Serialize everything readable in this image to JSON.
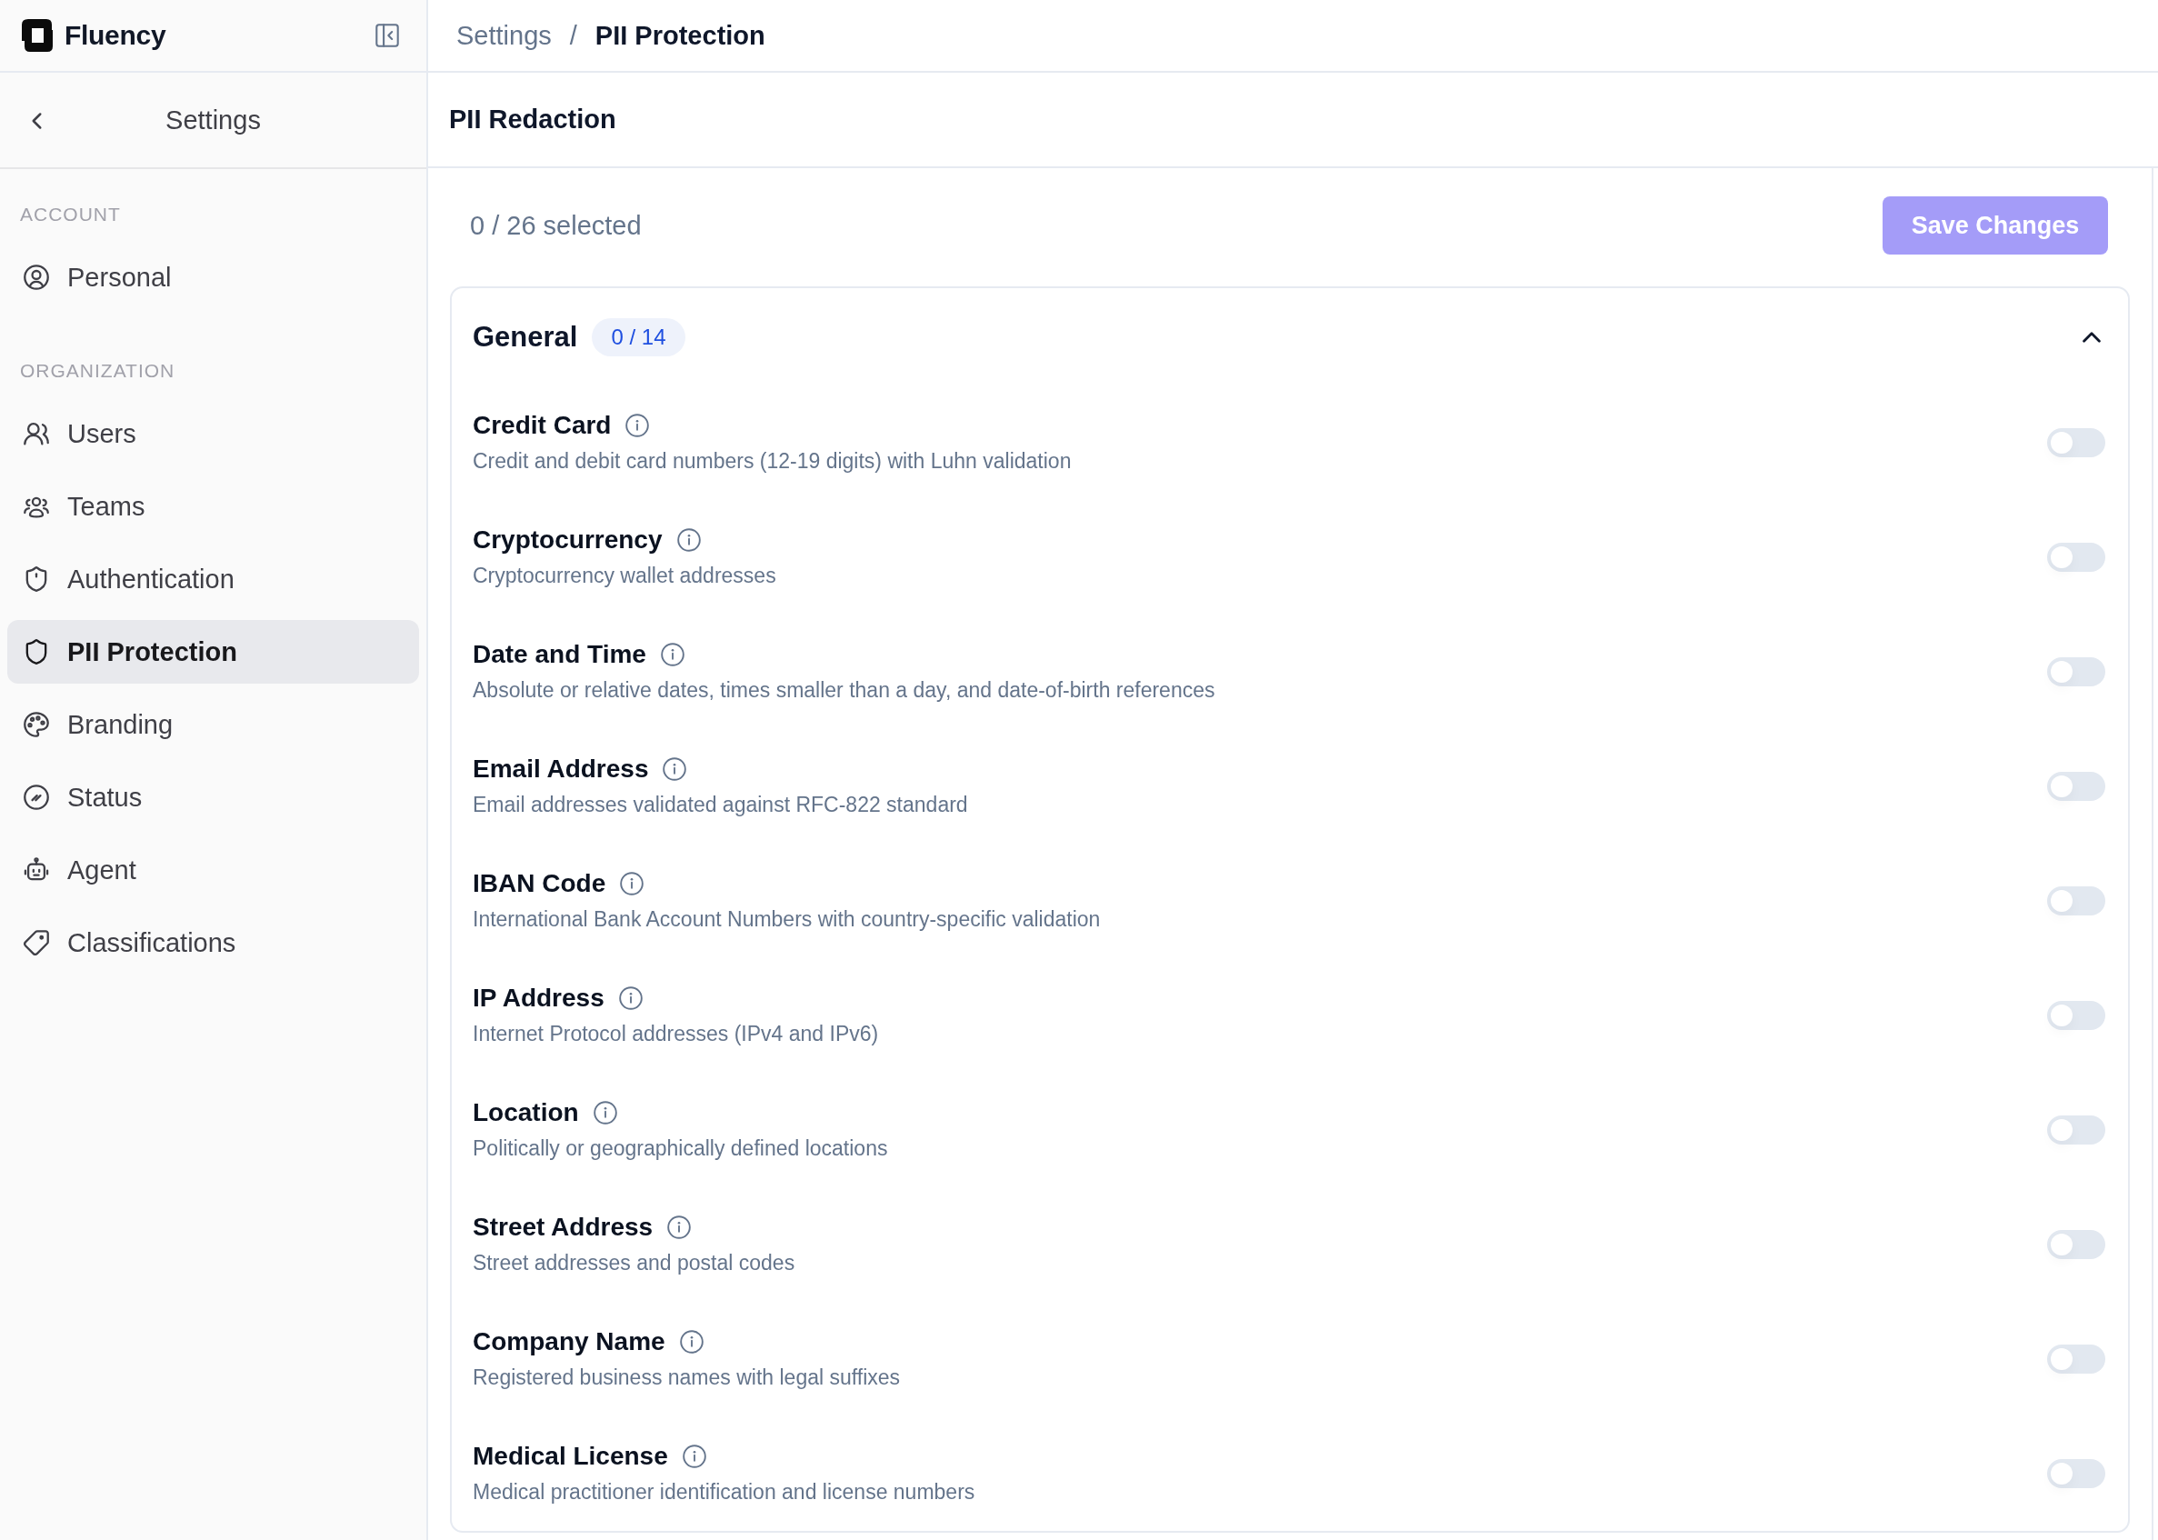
{
  "sidebar": {
    "brand": "Fluency",
    "title": "Settings",
    "sections": [
      {
        "label": "ACCOUNT",
        "items": [
          {
            "label": "Personal",
            "selected": false
          }
        ]
      },
      {
        "label": "ORGANIZATION",
        "items": [
          {
            "label": "Users",
            "selected": false
          },
          {
            "label": "Teams",
            "selected": false
          },
          {
            "label": "Authentication",
            "selected": false
          },
          {
            "label": "PII Protection",
            "selected": true
          },
          {
            "label": "Branding",
            "selected": false
          },
          {
            "label": "Status",
            "selected": false
          },
          {
            "label": "Agent",
            "selected": false
          },
          {
            "label": "Classifications",
            "selected": false
          }
        ]
      }
    ]
  },
  "breadcrumb": {
    "separator": "/",
    "items": [
      {
        "label": "Settings",
        "current": false
      },
      {
        "label": "PII Protection",
        "current": true
      }
    ]
  },
  "page_title": "PII Redaction",
  "toolbar": {
    "selection_count": "0 / 26 selected",
    "save_button": {
      "label": "Save Changes",
      "disabled": true
    }
  },
  "groups": [
    {
      "title": "General",
      "count": "0 / 14",
      "expanded": true,
      "items": [
        {
          "name": "Credit Card",
          "description": "Credit and debit card numbers (12-19 digits) with Luhn validation",
          "on": false
        },
        {
          "name": "Cryptocurrency",
          "description": "Cryptocurrency wallet addresses",
          "on": false
        },
        {
          "name": "Date and Time",
          "description": "Absolute or relative dates, times smaller than a day, and date-of-birth references",
          "on": false
        },
        {
          "name": "Email Address",
          "description": "Email addresses validated against RFC-822 standard",
          "on": false
        },
        {
          "name": "IBAN Code",
          "description": "International Bank Account Numbers with country-specific validation",
          "on": false
        },
        {
          "name": "IP Address",
          "description": "Internet Protocol addresses (IPv4 and IPv6)",
          "on": false
        },
        {
          "name": "Location",
          "description": "Politically or geographically defined locations",
          "on": false
        },
        {
          "name": "Street Address",
          "description": "Street addresses and postal codes",
          "on": false
        },
        {
          "name": "Company Name",
          "description": "Registered business names with legal suffixes",
          "on": false
        },
        {
          "name": "Medical License",
          "description": "Medical practitioner identification and license numbers",
          "on": false
        }
      ]
    }
  ]
}
